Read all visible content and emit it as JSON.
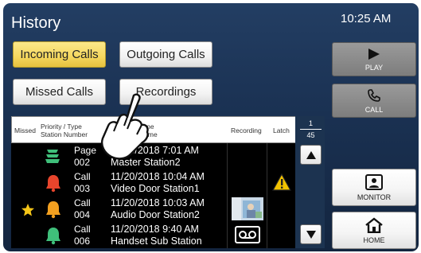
{
  "header": {
    "title": "History",
    "time": "10:25 AM"
  },
  "tabs": {
    "incoming": "Incoming Calls",
    "outgoing": "Outgoing Calls",
    "missed": "Missed Calls",
    "recordings": "Recordings"
  },
  "side": {
    "play": "PLAY",
    "call": "CALL",
    "monitor": "MONITOR",
    "home": "HOME"
  },
  "table": {
    "headers": {
      "missed": "Missed",
      "priority_line1": "Priority / Type",
      "priority_line2": "Station Number",
      "time_line1": "Time",
      "time_line2": "Name",
      "recording": "Recording",
      "latch": "Latch"
    },
    "page": {
      "current": "1",
      "total": "45"
    },
    "rows": [
      {
        "type": "Page",
        "number": "002",
        "time": "11/20/2018 7:01 AM",
        "name": "Master Station2",
        "icon": "page-speaker-icon",
        "color": "#3fbf7a"
      },
      {
        "type": "Call",
        "number": "003",
        "time": "11/20/2018 10:04 AM",
        "name": "Video Door Station1",
        "icon": "bell-icon",
        "color": "#e8452c"
      },
      {
        "type": "Call",
        "number": "004",
        "time": "11/20/2018 10:03 AM",
        "name": "Audio Door Station2",
        "icon": "bell-icon",
        "color": "#f2a020"
      },
      {
        "type": "Call",
        "number": "006",
        "time": "11/20/2018 9:40 AM",
        "name": "Handset Sub Station",
        "icon": "bell-icon",
        "color": "#3fbf7a"
      }
    ]
  },
  "colors": {
    "accent": "#f5d75e",
    "background": "#1a3152",
    "star": "#f5c518",
    "warning": "#f2c200"
  }
}
